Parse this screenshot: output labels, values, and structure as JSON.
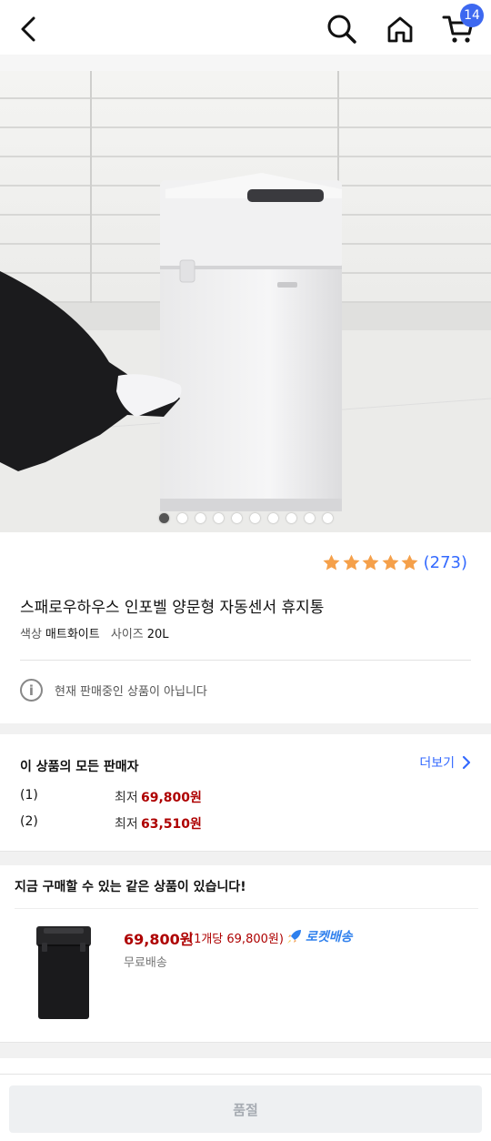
{
  "header": {
    "cart_count": "14",
    "icons": [
      "back-arrow-icon",
      "search-icon",
      "home-icon",
      "cart-icon"
    ]
  },
  "product": {
    "image_count": 10,
    "active_image_index": 0,
    "rating_stars": 5,
    "review_count": "(273)",
    "title": "스패로우하우스 인포벨 양문형 자동센서 휴지통",
    "option_color_label": "색상",
    "option_color_value": "매트화이트",
    "option_size_label": "사이즈",
    "option_size_value": "20L",
    "notice": "현재 판매중인 상품이 아닙니다"
  },
  "sellers": {
    "title": "이 상품의 모든 판매자",
    "more_label": "더보기",
    "rows": [
      {
        "num": "(1)",
        "low_label": "최저",
        "price": "69,800원"
      },
      {
        "num": "(2)",
        "low_label": "최저",
        "price": "63,510원"
      }
    ]
  },
  "same_product": {
    "title": "지금 구매할 수 있는 같은 상품이 있습니다!",
    "price": "69,800원",
    "unit_price": "(1개당 69,800원)",
    "rocket_label": "로켓배송",
    "shipping": "무료배송"
  },
  "bottom": {
    "button_label": "품절"
  },
  "colors": {
    "accent_blue": "#346aff",
    "price_red": "#ae0000",
    "star_orange": "#f5a04a",
    "badge_blue": "#3d68f0"
  }
}
